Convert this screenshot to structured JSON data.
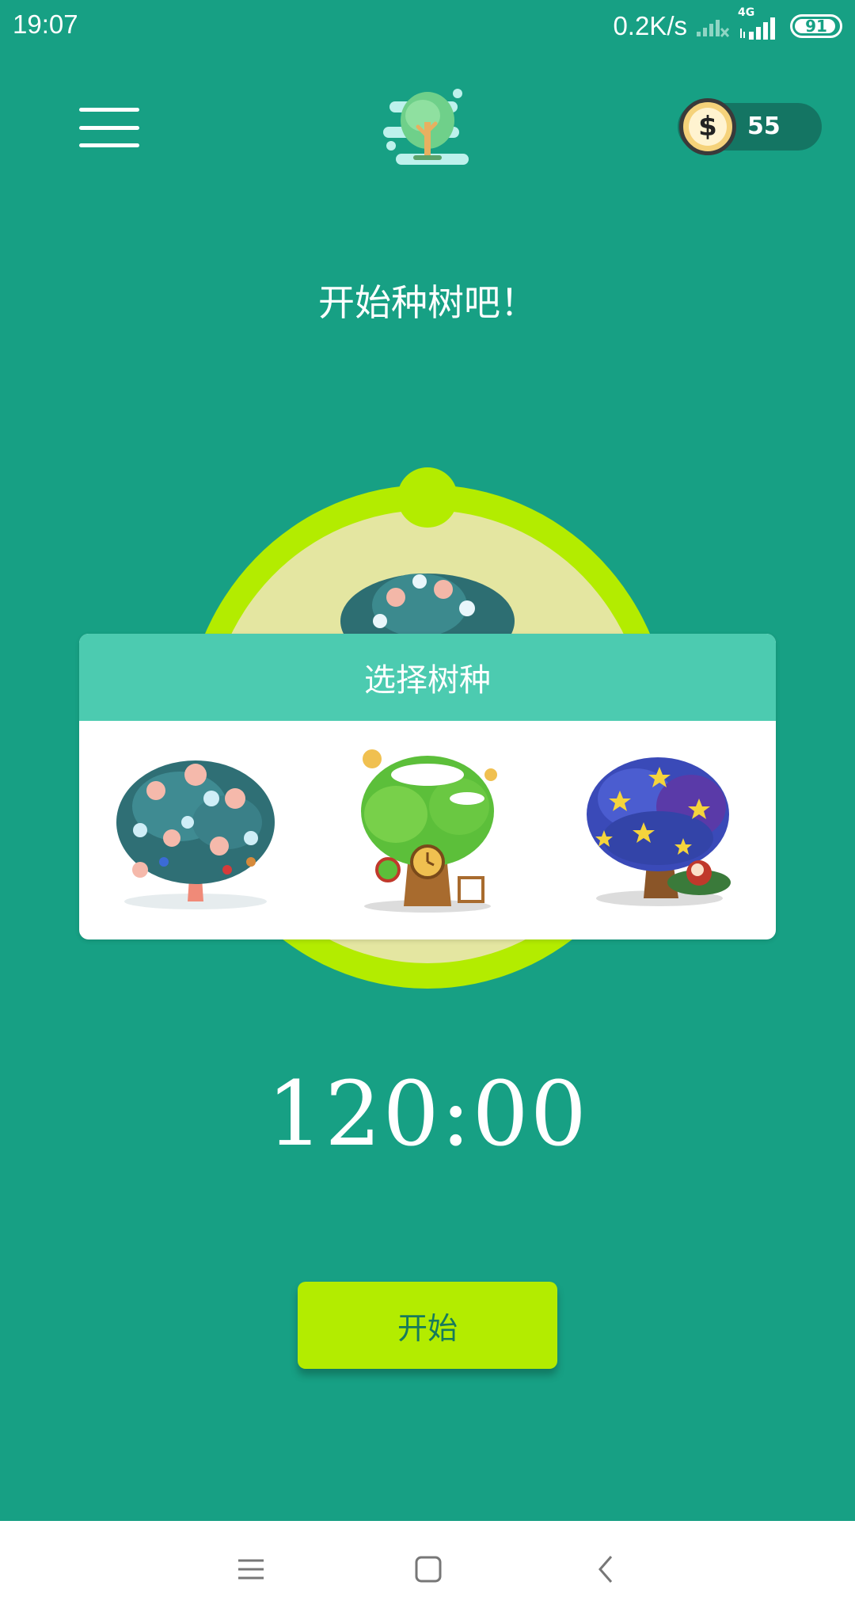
{
  "status_bar": {
    "time": "19:07",
    "net_speed": "0.2K/s",
    "network_type": "4G",
    "battery_level": "91"
  },
  "header": {
    "menu_icon": "hamburger-menu-icon",
    "logo_icon": "tree-logo-icon",
    "coin_icon": "dollar-coin-icon",
    "coin_symbol": "$",
    "coin_count": "55"
  },
  "main": {
    "title": "开始种树吧！",
    "timer": "120:00",
    "start_label": "开始"
  },
  "tree_picker": {
    "title": "选择树种",
    "options": [
      {
        "icon": "snowflake-tree-icon"
      },
      {
        "icon": "clock-tree-icon"
      },
      {
        "icon": "starry-night-tree-icon"
      }
    ]
  },
  "nav_bar": {
    "icons": [
      "menu-nav-icon",
      "home-nav-icon",
      "back-nav-icon"
    ]
  },
  "colors": {
    "background": "#17a084",
    "accent": "#b3ec00",
    "picker_header": "#4ccbb0",
    "button_text": "#177a5c"
  }
}
